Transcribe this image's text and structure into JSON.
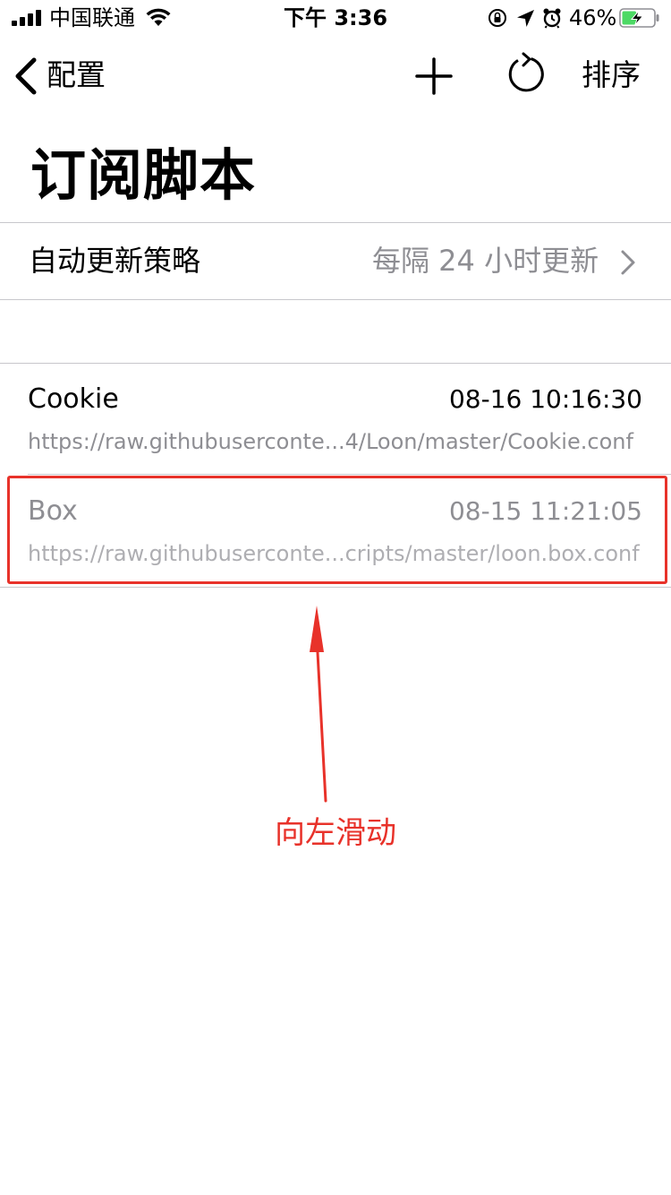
{
  "status_bar": {
    "carrier": "中国联通",
    "time": "下午 3:36",
    "battery_percent": "46%",
    "battery_level": 0.46,
    "icons": [
      "signal-icon",
      "wifi-icon",
      "rotation-lock-icon",
      "location-icon",
      "alarm-icon",
      "battery-charging-icon"
    ]
  },
  "nav": {
    "back_label": "配置",
    "add_icon": "plus-icon",
    "refresh_icon": "refresh-icon",
    "sort_label": "排序"
  },
  "page": {
    "title": "订阅脚本"
  },
  "settings": {
    "update_policy_label": "自动更新策略",
    "update_policy_value": "每隔 24 小时更新"
  },
  "subscriptions": [
    {
      "name": "Cookie",
      "updated": "08-16 10:16:30",
      "url": "https://raw.githubuserconte...4/Loon/master/Cookie.conf",
      "enabled": true
    },
    {
      "name": "Box",
      "updated": "08-15 11:21:05",
      "url": "https://raw.githubuserconte...cripts/master/loon.box.conf",
      "enabled": false
    }
  ],
  "annotation": {
    "text": "向左滑动",
    "color": "#e8322a"
  },
  "colors": {
    "secondary_text": "#8e8e93",
    "separator": "#c8c7cc",
    "battery_green": "#4cd964"
  }
}
